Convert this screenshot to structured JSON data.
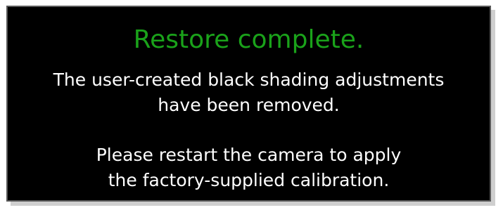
{
  "dialog": {
    "title": "Restore complete.",
    "message_1": [
      "The user-created black shading adjustments",
      "have been removed."
    ],
    "message_2": [
      "Please restart the camera to apply",
      "the factory-supplied calibration."
    ]
  },
  "colors": {
    "background": "#000000",
    "title": "#1aa21a",
    "text": "#ffffff"
  }
}
